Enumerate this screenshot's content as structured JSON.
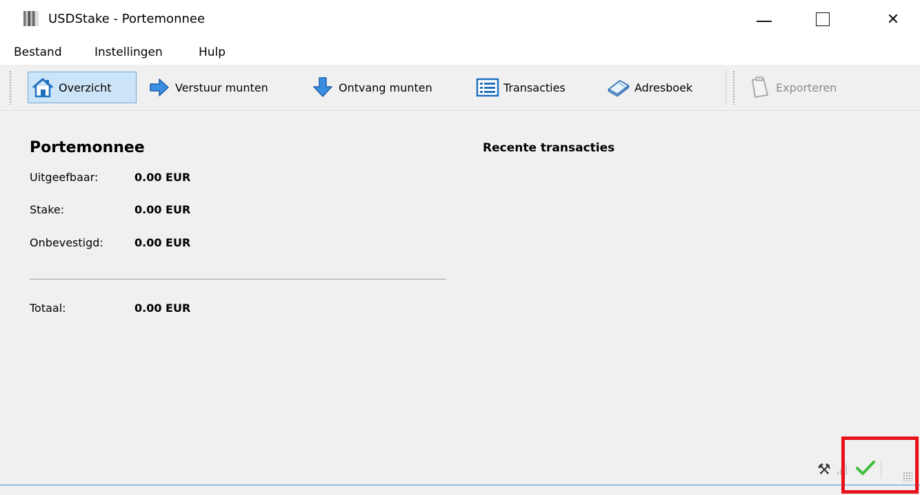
{
  "window": {
    "title": "USDStake - Portemonnee",
    "min_glyph": "—",
    "close_glyph": "✕"
  },
  "menu": {
    "items": [
      "Bestand",
      "Instellingen",
      "Hulp"
    ]
  },
  "toolbar": {
    "buttons": [
      {
        "label": "Overzicht",
        "icon": "home-icon",
        "active": true
      },
      {
        "label": "Verstuur munten",
        "icon": "send-arrow-icon"
      },
      {
        "label": "Ontvang munten",
        "icon": "receive-arrow-icon"
      },
      {
        "label": "Transacties",
        "icon": "transactions-list-icon"
      },
      {
        "label": "Adresboek",
        "icon": "address-book-icon"
      },
      {
        "label": "Exporteren",
        "icon": "clipboard-icon",
        "disabled": true
      }
    ]
  },
  "wallet": {
    "title": "Portemonnee",
    "rows": [
      {
        "label": "Uitgeefbaar:",
        "value": "0.00 EUR"
      },
      {
        "label": "Stake:",
        "value": "0.00 EUR"
      },
      {
        "label": "Onbevestigd:",
        "value": "0.00 EUR"
      }
    ],
    "total": {
      "label": "Totaal:",
      "value": "0.00 EUR"
    }
  },
  "recent": {
    "title": "Recente transacties"
  },
  "status": {
    "icons": [
      "tools-icon",
      "signal-bars-icon",
      "sync-ok-check-icon"
    ],
    "tools_glyph": "⚒"
  },
  "colors": {
    "accent": "#3d8fd6",
    "highlight": "#e8121d",
    "active_button_bg": "#cce4f7",
    "check": "#3cbf3a"
  }
}
